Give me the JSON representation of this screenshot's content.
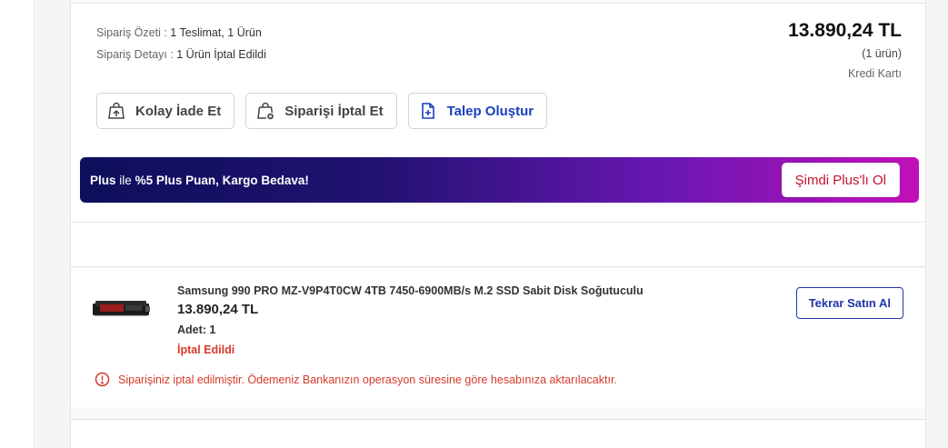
{
  "order_summary": {
    "summary_key": "Sipariş Özeti :",
    "summary_value": "1 Teslimat, 1 Ürün",
    "detail_key": "Sipariş Detayı :",
    "detail_value": "1 Ürün İptal Edildi",
    "total": "13.890,24 TL",
    "item_count": "(1 ürün)",
    "payment_method": "Kredi Kartı"
  },
  "actions": {
    "return_label": "Kolay İade Et",
    "cancel_label": "Siparişi İptal Et",
    "ticket_label": "Talep Oluştur"
  },
  "plus_banner": {
    "brand": "Plus",
    "connector": "ile",
    "offer": "%5 Plus Puan, Kargo Bedava!",
    "cta_label": "Şimdi Plus'lı Ol"
  },
  "product": {
    "name": "Samsung 990 PRO MZ-V9P4T0CW 4TB 7450-6900MB/s M.2 SSD Sabit Disk Soğutuculu",
    "price": "13.890,24 TL",
    "quantity": "Adet: 1",
    "status": "İptal Edildi",
    "rebuy_label": "Tekrar Satın Al",
    "cancel_note": "Siparişiniz iptal edilmiştir. Ödemeniz Bankanızın operasyon süresine göre hesabınıza aktarılacaktır."
  },
  "colors": {
    "accent_blue": "#1a3fc1",
    "error_red": "#d63a2b",
    "banner_start": "#0d0f5b",
    "banner_end": "#c10fb8"
  },
  "icons": {
    "return": "bag-return-icon",
    "cancel": "bag-cancel-icon",
    "ticket": "document-plus-icon",
    "info": "error-circle-icon"
  }
}
